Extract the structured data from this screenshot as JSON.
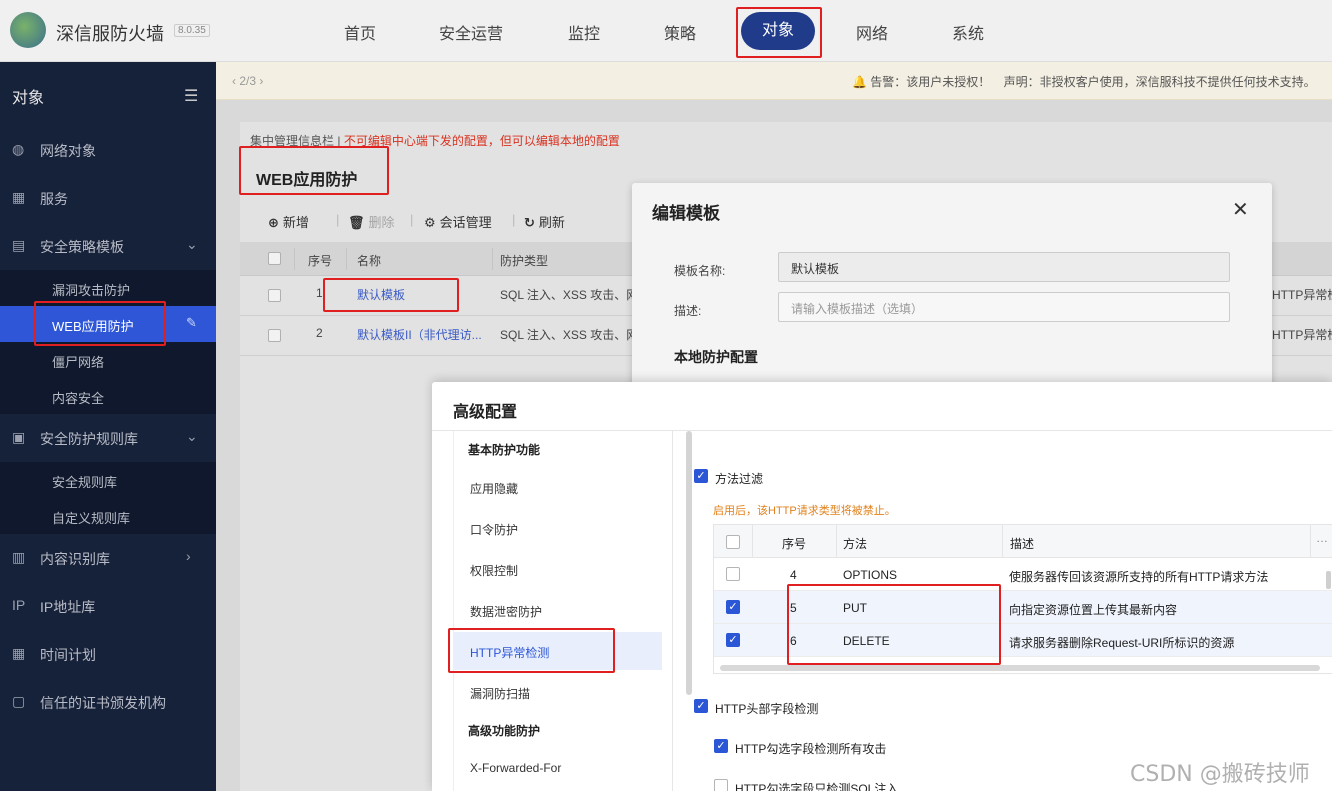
{
  "header": {
    "brand": "深信服防火墙",
    "version": "8.0.35",
    "nav": [
      "首页",
      "安全运营",
      "监控",
      "策略",
      "对象",
      "网络",
      "系统"
    ],
    "active_nav": "对象"
  },
  "sidebar": {
    "title": "对象",
    "items": [
      {
        "label": "网络对象",
        "icon": "globe-icon"
      },
      {
        "label": "服务",
        "icon": "grid-icon"
      },
      {
        "label": "安全策略模板",
        "icon": "template-icon",
        "expanded": true
      },
      {
        "label": "漏洞攻击防护"
      },
      {
        "label": "WEB应用防护",
        "active": true
      },
      {
        "label": "僵尸网络"
      },
      {
        "label": "内容安全"
      },
      {
        "label": "安全防护规则库",
        "icon": "rules-icon",
        "expanded": true
      },
      {
        "label": "安全规则库"
      },
      {
        "label": "自定义规则库"
      },
      {
        "label": "内容识别库",
        "icon": "content-icon"
      },
      {
        "label": "IP地址库",
        "icon": "ip-icon"
      },
      {
        "label": "时间计划",
        "icon": "calendar-icon"
      },
      {
        "label": "信任的证书颁发机构",
        "icon": "cert-icon"
      }
    ]
  },
  "topbar": {
    "pager": "2/3",
    "warning": "告警：该用户未授权！",
    "statement": "声明：非授权客户使用，深信服科技不提供任何技术支持。"
  },
  "page": {
    "info_prefix": "集中管理信息栏",
    "info_red": "不可编辑中心端下发的配置，但可以编辑本地的配置",
    "title": "WEB应用防护",
    "toolbar": {
      "add": "新增",
      "delete": "删除",
      "session": "会话管理",
      "refresh": "刷新"
    },
    "columns": [
      "序号",
      "名称",
      "防护类型"
    ],
    "rows": [
      {
        "idx": "1",
        "name": "默认模板",
        "type": "SQL 注入、XSS 攻击、网",
        "tail": "HTTP异常检"
      },
      {
        "idx": "2",
        "name": "默认模板II（非代理访...",
        "type": "SQL 注入、XSS 攻击、网",
        "tail": "HTTP异常检"
      }
    ]
  },
  "edit_dialog": {
    "title": "编辑模板",
    "name_label": "模板名称:",
    "name_value": "默认模板",
    "desc_label": "描述:",
    "desc_placeholder": "请输入模板描述（选填）",
    "section": "本地防护配置"
  },
  "adv_dialog": {
    "title": "高级配置",
    "groups": [
      {
        "label": "基本防护功能",
        "items": [
          "应用隐藏",
          "口令防护",
          "权限控制",
          "数据泄密防护",
          "HTTP异常检测",
          "漏洞防扫描"
        ]
      },
      {
        "label": "高级功能防护",
        "items": [
          "X-Forwarded-For"
        ]
      }
    ],
    "active_item": "HTTP异常检测",
    "method_filter": {
      "label": "方法过滤",
      "checked": true,
      "hint": "启用后，该HTTP请求类型将被禁止。"
    },
    "method_table": {
      "columns": [
        "序号",
        "方法",
        "描述"
      ],
      "rows": [
        {
          "idx": "4",
          "method": "OPTIONS",
          "desc": "使服务器传回该资源所支持的所有HTTP请求方法",
          "checked": false
        },
        {
          "idx": "5",
          "method": "PUT",
          "desc": "向指定资源位置上传其最新内容",
          "checked": true
        },
        {
          "idx": "6",
          "method": "DELETE",
          "desc": "请求服务器删除Request-URI所标识的资源",
          "checked": true
        }
      ]
    },
    "header_check": {
      "label": "HTTP头部字段检测",
      "checked": true
    },
    "sub_all": {
      "label": "HTTP勾选字段检测所有攻击",
      "checked": true
    },
    "sub_sql": {
      "label": "HTTP勾选字段只检测SQL注入",
      "checked": false
    }
  },
  "watermark": "CSDN @搬砖技师"
}
